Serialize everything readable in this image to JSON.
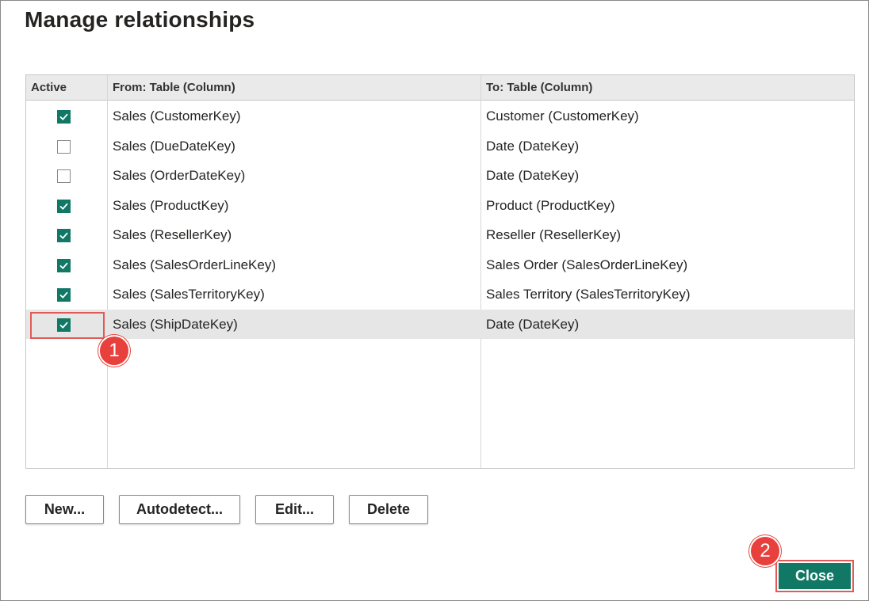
{
  "dialog": {
    "title": "Manage relationships"
  },
  "grid": {
    "columns": {
      "active": "Active",
      "from": "From: Table (Column)",
      "to": "To: Table (Column)"
    },
    "rows": [
      {
        "active": true,
        "from": "Sales (CustomerKey)",
        "to": "Customer (CustomerKey)"
      },
      {
        "active": false,
        "from": "Sales (DueDateKey)",
        "to": "Date (DateKey)"
      },
      {
        "active": false,
        "from": "Sales (OrderDateKey)",
        "to": "Date (DateKey)"
      },
      {
        "active": true,
        "from": "Sales (ProductKey)",
        "to": "Product (ProductKey)"
      },
      {
        "active": true,
        "from": "Sales (ResellerKey)",
        "to": "Reseller (ResellerKey)"
      },
      {
        "active": true,
        "from": "Sales (SalesOrderLineKey)",
        "to": "Sales Order (SalesOrderLineKey)"
      },
      {
        "active": true,
        "from": "Sales (SalesTerritoryKey)",
        "to": "Sales Territory (SalesTerritoryKey)"
      },
      {
        "active": true,
        "from": "Sales (ShipDateKey)",
        "to": "Date (DateKey)",
        "selected": true
      }
    ]
  },
  "buttons": {
    "new": "New...",
    "autodetect": "Autodetect...",
    "edit": "Edit...",
    "delete": "Delete",
    "close": "Close"
  },
  "annotations": {
    "step1": "1",
    "step2": "2"
  },
  "colors": {
    "accent": "#117865",
    "annotation": "#e8403c"
  },
  "icons": {
    "checkbox_checked": "checkmark-icon"
  }
}
